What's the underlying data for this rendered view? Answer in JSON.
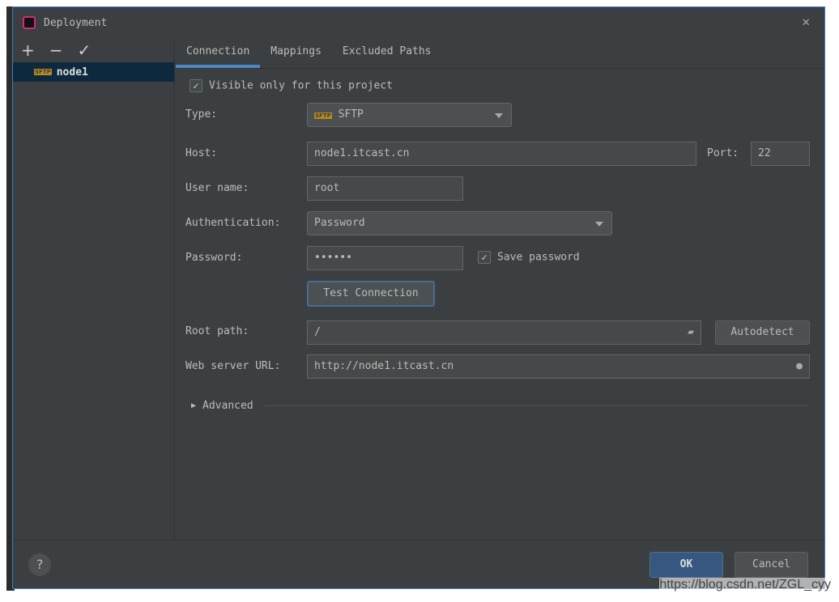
{
  "window": {
    "title": "Deployment"
  },
  "sidebar": {
    "add": "+",
    "remove": "−",
    "apply": "✓",
    "items": [
      {
        "label": "node1",
        "badge": "SFTP"
      }
    ]
  },
  "tabs": [
    {
      "label": "Connection",
      "active": true
    },
    {
      "label": "Mappings"
    },
    {
      "label": "Excluded Paths"
    }
  ],
  "form": {
    "visible_only": {
      "label": "Visible only for this project",
      "checked": true
    },
    "type": {
      "label": "Type:",
      "value": "SFTP"
    },
    "host": {
      "label": "Host:",
      "value": "node1.itcast.cn"
    },
    "port": {
      "label": "Port:",
      "value": "22"
    },
    "username": {
      "label": "User name:",
      "value": "root"
    },
    "auth": {
      "label": "Authentication:",
      "value": "Password"
    },
    "password": {
      "label": "Password:",
      "value": "••••••"
    },
    "save_password": {
      "label": "Save password",
      "checked": true
    },
    "test_connection": "Test Connection",
    "root_path": {
      "label": "Root path:",
      "value": "/"
    },
    "autodetect": "Autodetect",
    "web_url": {
      "label": "Web server URL:",
      "value": "http://node1.itcast.cn"
    },
    "advanced": "Advanced"
  },
  "footer": {
    "help": "?",
    "ok": "OK",
    "cancel": "Cancel"
  },
  "watermark": "https://blog.csdn.net/ZGL_cyy",
  "colors": {
    "accent": "#4a88c7",
    "ok": "#365880",
    "bg": "#3c3f41"
  }
}
